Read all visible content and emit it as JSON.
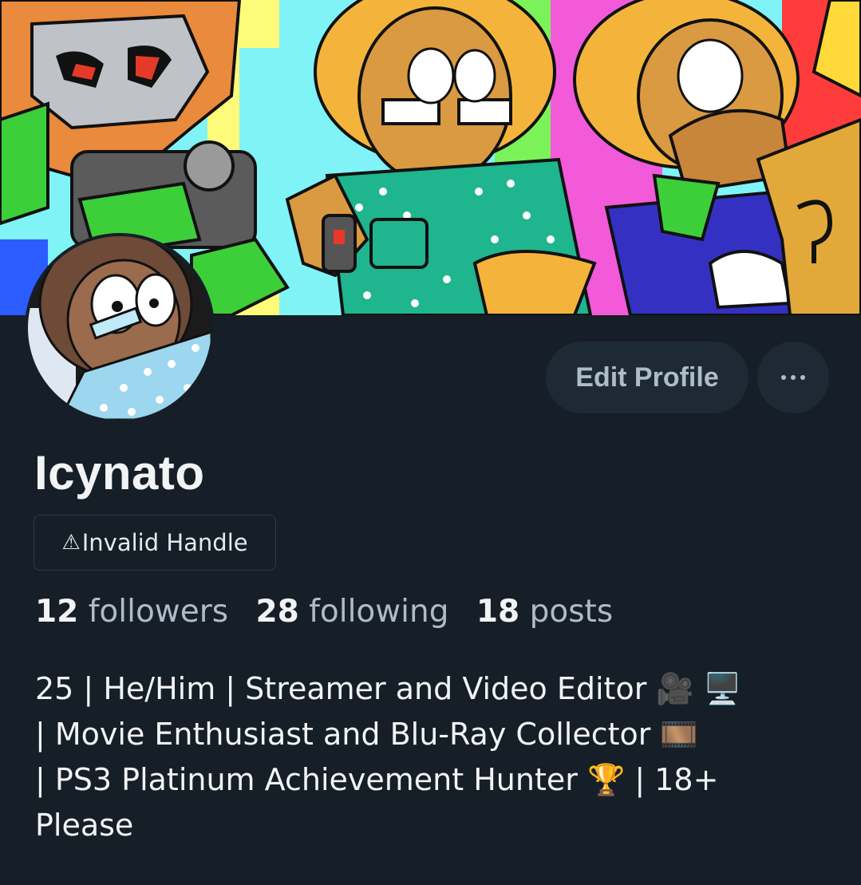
{
  "profile": {
    "display_name": "Icynato",
    "handle_badge": "Invalid Handle",
    "handle_warning_icon": "warning-icon",
    "stats": {
      "followers_count": "12",
      "followers_label": "followers",
      "following_count": "28",
      "following_label": "following",
      "posts_count": "18",
      "posts_label": "posts"
    },
    "bio_lines": [
      "25 | He/Him | Streamer and Video Editor 🎥 🖥️",
      "| Movie Enthusiast and Blu-Ray Collector 🎞️",
      "| PS3 Platinum Achievement Hunter 🏆 | 18+",
      "Please"
    ]
  },
  "actions": {
    "edit_profile_label": "Edit Profile",
    "more_icon": "ellipsis-icon"
  },
  "colors": {
    "background": "#161e27",
    "button_bg": "#1e2936",
    "muted_text": "#aebbc9",
    "primary_text": "#f1f3f5"
  }
}
